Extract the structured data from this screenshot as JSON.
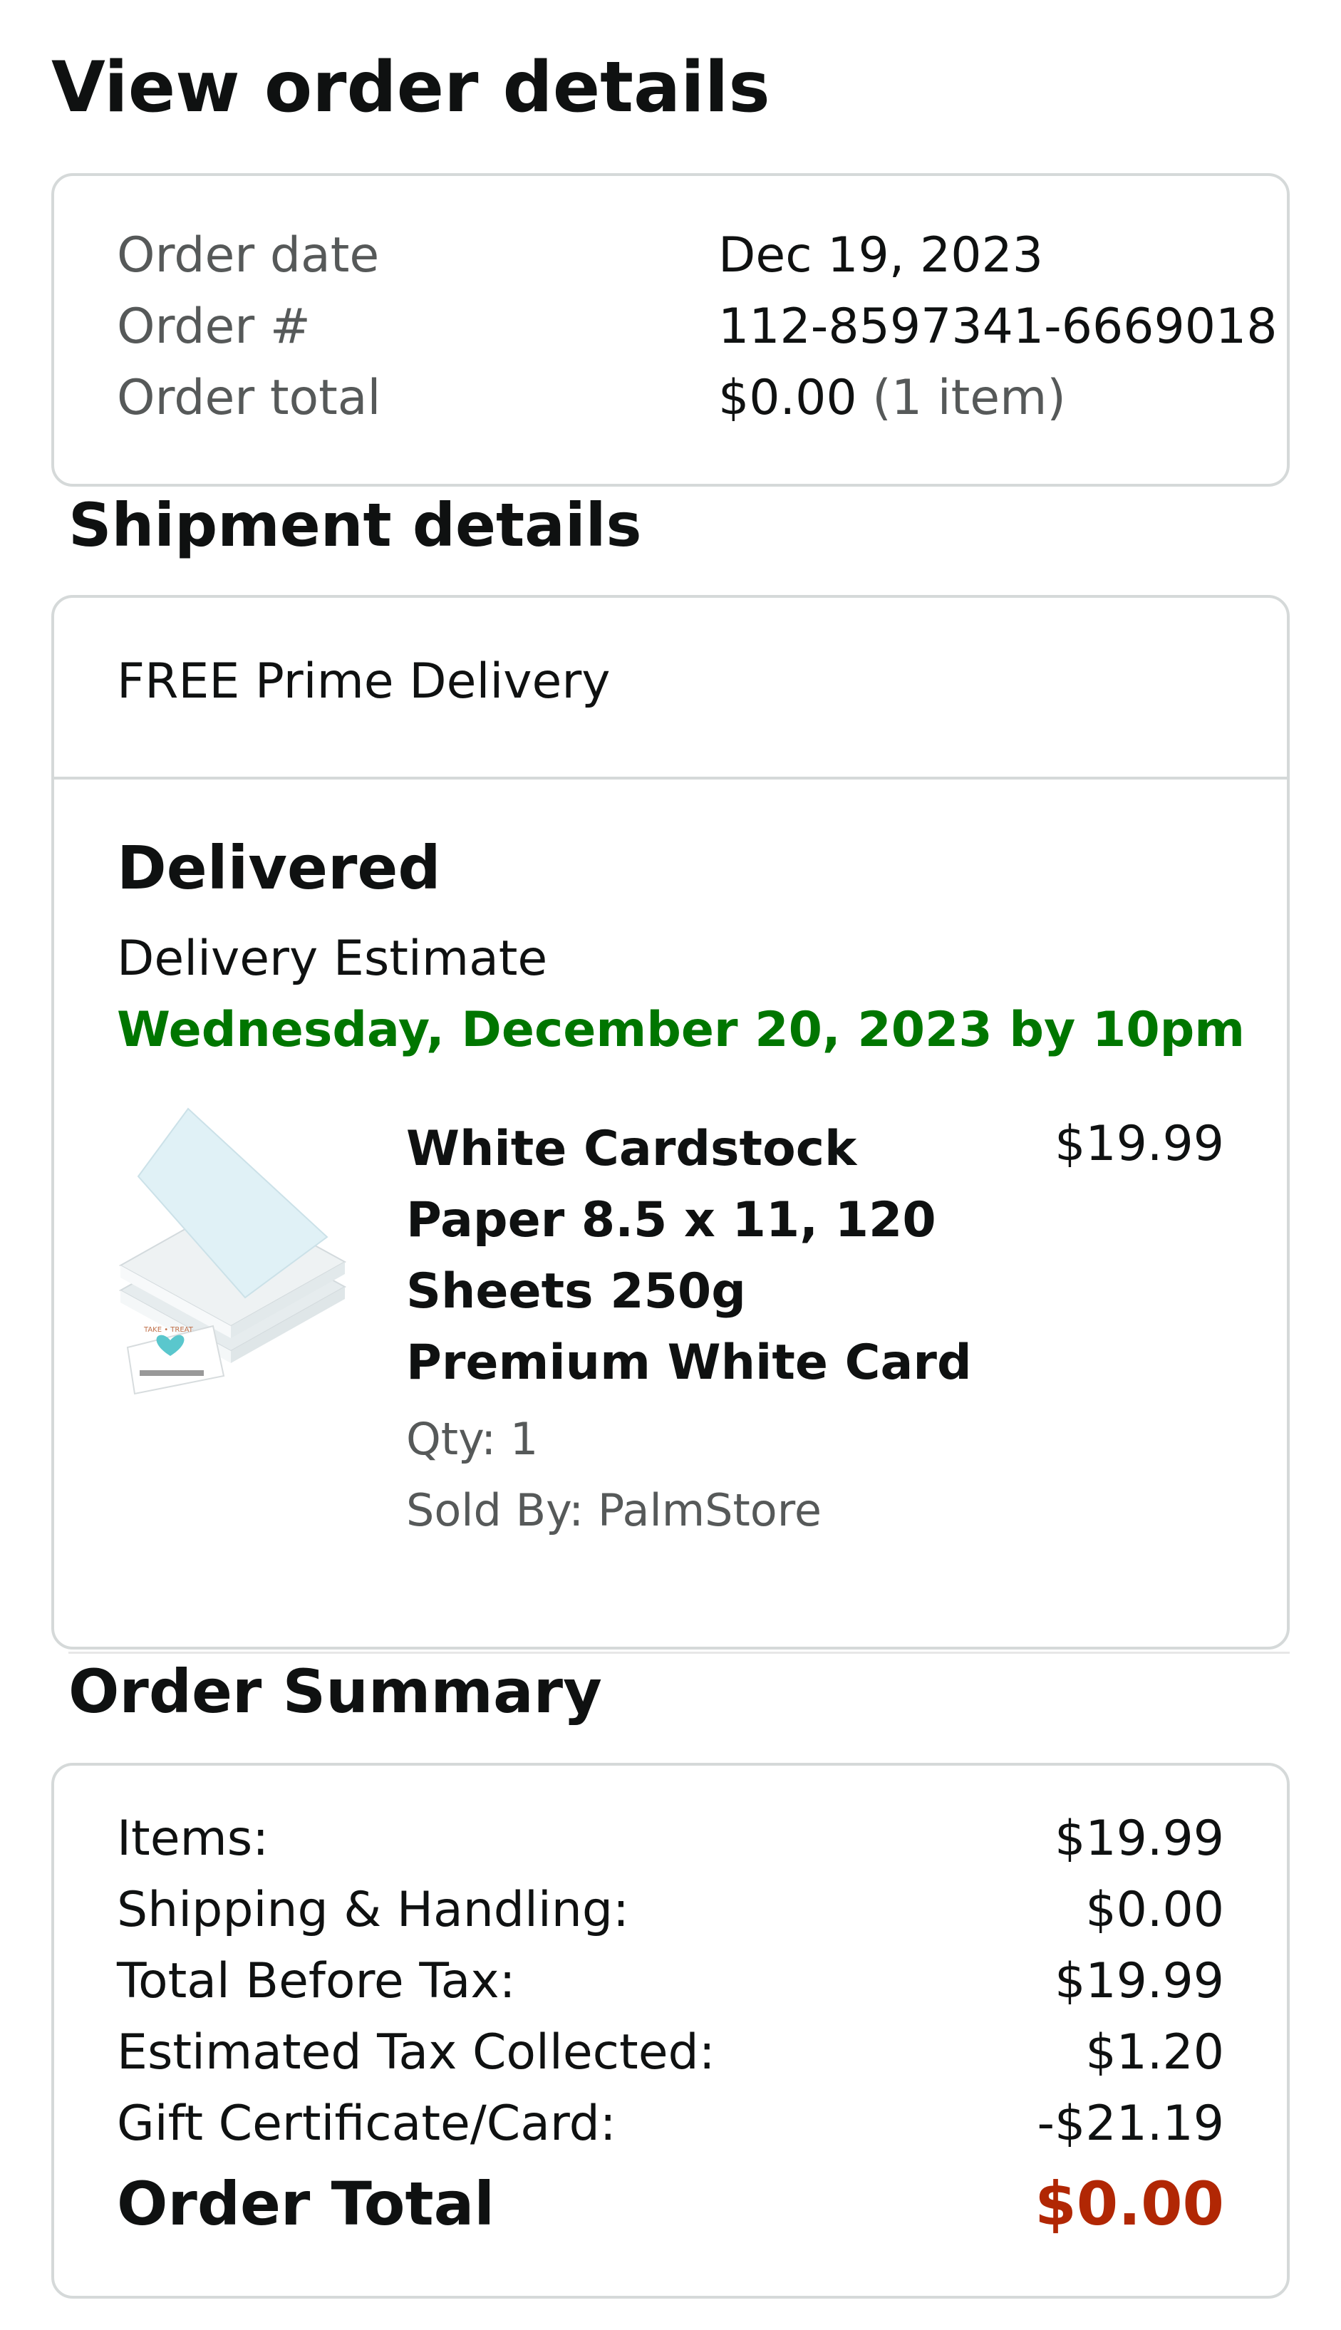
{
  "page": {
    "title": "View order details"
  },
  "order": {
    "date_label": "Order date",
    "date_value": "Dec 19, 2023",
    "number_label": "Order #",
    "number_value": "112-8597341-6669018",
    "total_label": "Order total",
    "total_value": "$0.00",
    "total_items": "(1 item)"
  },
  "shipment": {
    "section_title": "Shipment details",
    "method": "FREE Prime Delivery",
    "status": "Delivered",
    "estimate_label": "Delivery Estimate",
    "estimate_date": "Wednesday, December 20, 2023 by 10pm",
    "item": {
      "title_lines": [
        "White Cardstock",
        "Paper 8.5 x 11, 120",
        "Sheets 250g",
        "Premium White Card"
      ],
      "price": "$19.99",
      "qty": "Qty: 1",
      "seller": "Sold By: PalmStore",
      "image_icon": "cardstock-product-image"
    }
  },
  "summary": {
    "section_title": "Order Summary",
    "rows": [
      {
        "label": "Items:",
        "value": "$19.99"
      },
      {
        "label": "Shipping & Handling:",
        "value": "$0.00"
      },
      {
        "label": "Total Before Tax:",
        "value": "$19.99"
      },
      {
        "label": "Estimated Tax Collected:",
        "value": "$1.20"
      },
      {
        "label": "Gift Certificate/Card:",
        "value": "-$21.19"
      }
    ],
    "total_label": "Order Total",
    "total_value": "$0.00"
  },
  "colors": {
    "text": "#0f1111",
    "muted": "#565959",
    "delivery_green": "#007600",
    "total_red": "#b12704",
    "border": "#d5d9d9"
  }
}
